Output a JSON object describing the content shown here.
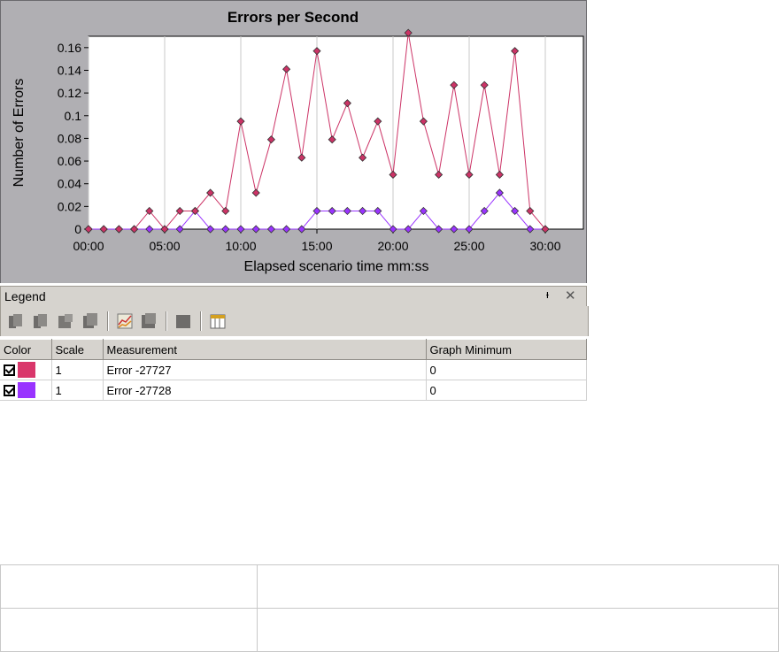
{
  "chart_data": {
    "type": "line",
    "title": "Errors per Second",
    "xlabel": "Elapsed scenario time mm:ss",
    "ylabel": "Number of Errors",
    "x_ticks": [
      "00:00",
      "05:00",
      "10:00",
      "15:00",
      "20:00",
      "25:00",
      "30:00"
    ],
    "y_ticks": [
      "0",
      "0.02",
      "0.04",
      "0.06",
      "0.08",
      "0.1",
      "0.12",
      "0.14",
      "0.16"
    ],
    "xlim": [
      0,
      1950
    ],
    "ylim": [
      0,
      0.17
    ],
    "x_seconds": [
      0,
      60,
      120,
      180,
      240,
      300,
      360,
      420,
      480,
      540,
      600,
      660,
      720,
      780,
      840,
      900,
      960,
      1020,
      1080,
      1140,
      1200,
      1260,
      1320,
      1380,
      1440,
      1500,
      1560,
      1620,
      1680,
      1740,
      1800,
      1860,
      1920
    ],
    "series": [
      {
        "color": "#cc3366",
        "values": [
          0,
          0,
          0,
          0,
          0.016,
          0,
          0.016,
          0.016,
          0.032,
          0.016,
          0.095,
          0.032,
          0.079,
          0.141,
          0.063,
          0.157,
          0.079,
          0.111,
          0.063,
          0.095,
          0.048,
          0.173,
          0.095,
          0.048,
          0.127,
          0.048,
          0.127,
          0.048,
          0.157,
          0.016,
          0
        ]
      },
      {
        "color": "#9933ff",
        "values": [
          0,
          0,
          0,
          0,
          0,
          0,
          0,
          0.016,
          0,
          0,
          0,
          0,
          0,
          0,
          0,
          0.016,
          0.016,
          0.016,
          0.016,
          0.016,
          0,
          0,
          0.016,
          0,
          0,
          0,
          0.016,
          0.032,
          0.016,
          0,
          0
        ]
      }
    ]
  },
  "legend": {
    "title": "Legend",
    "columns": [
      "Color",
      "Scale",
      "Measurement",
      "Graph Minimum"
    ],
    "rows": [
      {
        "checked": true,
        "color": "#d9376b",
        "scale": "1",
        "measurement": "Error -27727",
        "graph_minimum": "0"
      },
      {
        "checked": true,
        "color": "#9933ff",
        "scale": "1",
        "measurement": "Error -27728",
        "graph_minimum": "0"
      }
    ]
  },
  "toolbar_icons": [
    "show-all-icon",
    "hide-all-icon",
    "show-selected-icon",
    "hide-selected-icon",
    "graph-icon",
    "configure-icon",
    "filter-icon",
    "columns-icon"
  ]
}
